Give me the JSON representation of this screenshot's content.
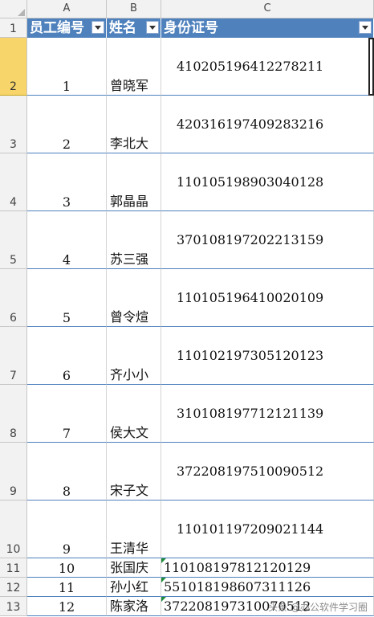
{
  "columns": [
    "A",
    "B",
    "C"
  ],
  "header": {
    "col_a": "员工编号",
    "col_b": "姓名",
    "col_c": "身份证号"
  },
  "rows": [
    {
      "row": "1"
    },
    {
      "row": "2",
      "no": "1",
      "name": "曾晓军",
      "id": "410205196412278211"
    },
    {
      "row": "3",
      "no": "2",
      "name": "李北大",
      "id": "420316197409283216"
    },
    {
      "row": "4",
      "no": "3",
      "name": "郭晶晶",
      "id": "110105198903040128"
    },
    {
      "row": "5",
      "no": "4",
      "name": "苏三强",
      "id": "370108197202213159"
    },
    {
      "row": "6",
      "no": "5",
      "name": "曾令煊",
      "id": "110105196410020109"
    },
    {
      "row": "7",
      "no": "6",
      "name": "齐小小",
      "id": "110102197305120123"
    },
    {
      "row": "8",
      "no": "7",
      "name": "侯大文",
      "id": "310108197712121139"
    },
    {
      "row": "9",
      "no": "8",
      "name": "宋子文",
      "id": "372208197510090512"
    },
    {
      "row": "10",
      "no": "9",
      "name": "王清华",
      "id": "110101197209021144"
    },
    {
      "row": "11",
      "no": "10",
      "name": "张国庆",
      "id": "110108197812120129"
    },
    {
      "row": "12",
      "no": "11",
      "name": "孙小红",
      "id": "551018198607311126"
    },
    {
      "row": "13",
      "no": "12",
      "name": "陈家洛",
      "id": "372208197310070512"
    }
  ],
  "watermark": "头条 @办公软件学习圈",
  "colors": {
    "header_fill": "#4f81bd",
    "selected_row": "#f7d56a",
    "error_marker": "#1e8c3a"
  }
}
